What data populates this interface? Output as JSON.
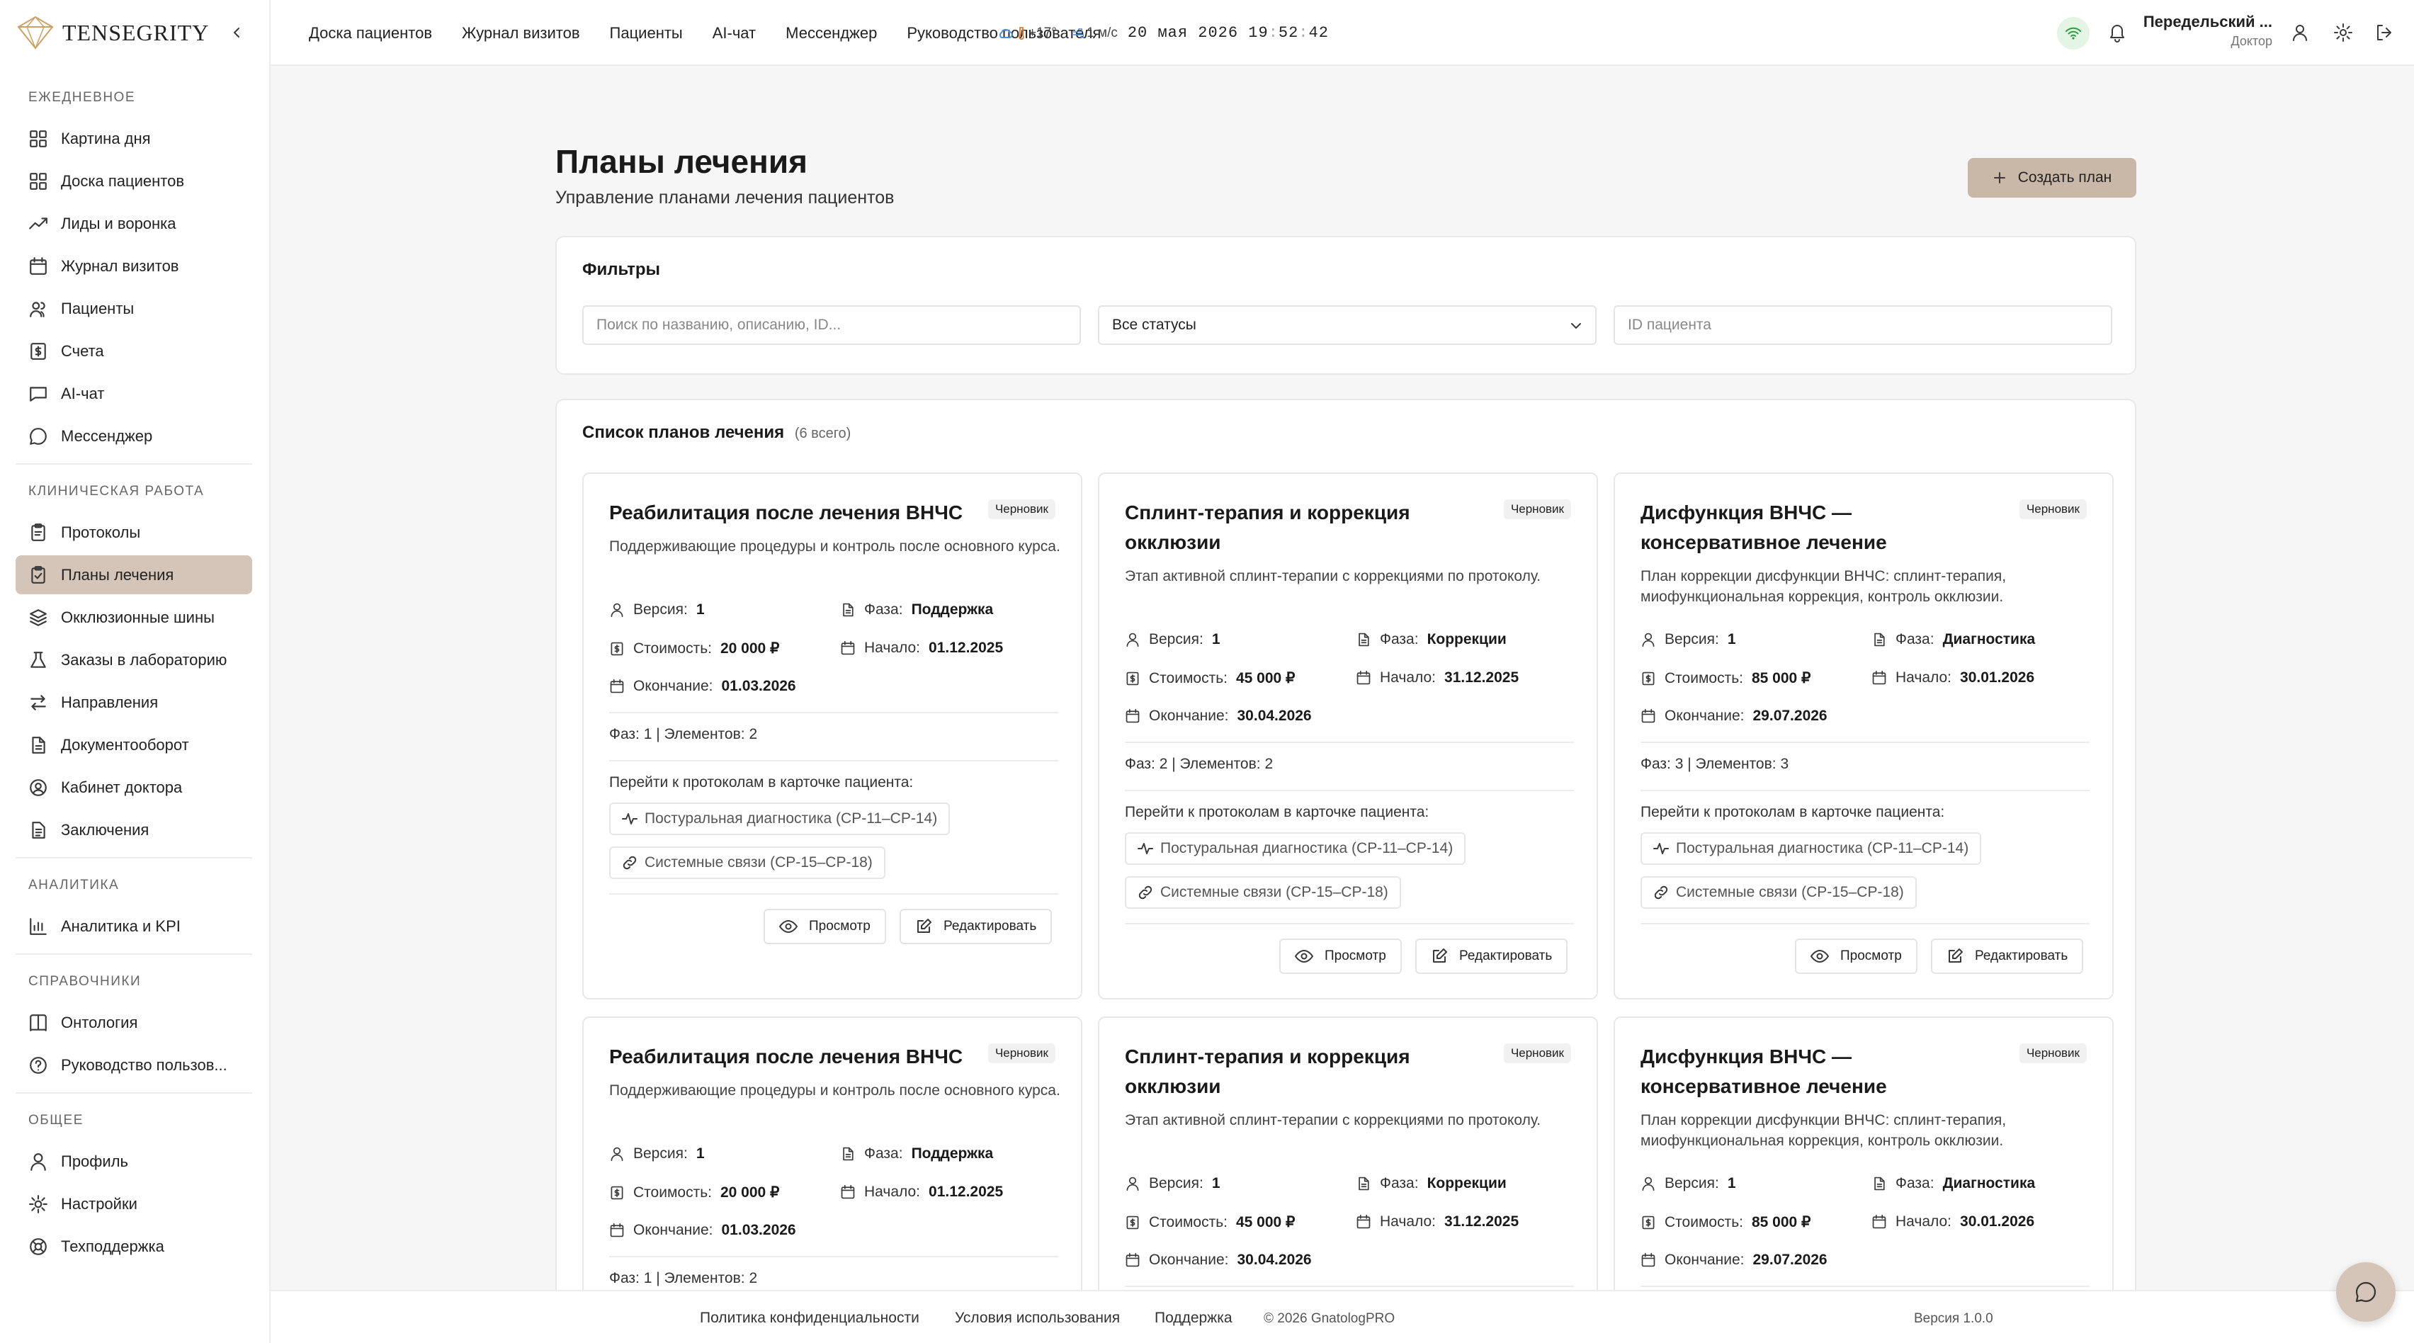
{
  "app": {
    "brand": "Tensegrity"
  },
  "sidebar": {
    "sections": [
      {
        "title": "Ежедневное",
        "items": [
          {
            "label": "Картина дня",
            "icon": "grid-icon"
          },
          {
            "label": "Доска пациентов",
            "icon": "grid-icon"
          },
          {
            "label": "Лиды и воронка",
            "icon": "trend-icon"
          },
          {
            "label": "Журнал визитов",
            "icon": "calendar-icon"
          },
          {
            "label": "Пациенты",
            "icon": "users-icon"
          },
          {
            "label": "Счета",
            "icon": "dollar-icon"
          },
          {
            "label": "AI-чат",
            "icon": "chat-icon"
          },
          {
            "label": "Мессенджер",
            "icon": "message-circle-icon"
          }
        ]
      },
      {
        "title": "Клиническая работа",
        "items": [
          {
            "label": "Протоколы",
            "icon": "clipboard-icon"
          },
          {
            "label": "Планы лечения",
            "icon": "clipboard-check-icon",
            "active": true
          },
          {
            "label": "Окклюзионные шины",
            "icon": "layers-icon"
          },
          {
            "label": "Заказы в лабораторию",
            "icon": "flask-icon"
          },
          {
            "label": "Направления",
            "icon": "arrows-icon"
          },
          {
            "label": "Документооборот",
            "icon": "file-icon"
          },
          {
            "label": "Кабинет доктора",
            "icon": "user-circle-icon"
          },
          {
            "label": "Заключения",
            "icon": "file-text-icon"
          }
        ]
      },
      {
        "title": "Аналитика",
        "items": [
          {
            "label": "Аналитика и KPI",
            "icon": "bar-chart-icon"
          }
        ]
      },
      {
        "title": "Справочники",
        "items": [
          {
            "label": "Онтология",
            "icon": "book-icon"
          },
          {
            "label": "Руководство пользов...",
            "icon": "help-circle-icon"
          }
        ]
      },
      {
        "title": "Общее",
        "items": [
          {
            "label": "Профиль",
            "icon": "user-icon"
          },
          {
            "label": "Настройки",
            "icon": "gear-icon"
          },
          {
            "label": "Техподдержка",
            "icon": "life-buoy-icon"
          }
        ]
      }
    ]
  },
  "topbar": {
    "nav": [
      "Доска пациентов",
      "Журнал визитов",
      "Пациенты",
      "AI-чат",
      "Мессенджер",
      "Руководство пользователя"
    ],
    "weather": {
      "temp": "+17°",
      "wind": "1 м/с"
    },
    "datetime": {
      "date": "20 мая 2026",
      "hh": "19",
      "mm": "52",
      "ss": "42"
    },
    "user": {
      "name": "Передельский ...",
      "role": "Доктор"
    }
  },
  "page": {
    "title": "Планы лечения",
    "subtitle": "Управление планами лечения пациентов",
    "create_label": "Создать план"
  },
  "filters": {
    "title": "Фильтры",
    "search_placeholder": "Поиск по названию, описанию, ID...",
    "status_value": "Все статусы",
    "patient_placeholder": "ID пациента"
  },
  "list": {
    "title": "Список планов лечения",
    "count": "(6 всего)",
    "labels": {
      "version": "Версия:",
      "phase": "Фаза:",
      "cost": "Стоимость:",
      "start": "Начало:",
      "end": "Окончание:",
      "hint": "Перейти к протоколам в карточке пациента:",
      "view": "Просмотр",
      "edit": "Редактировать"
    },
    "plans": [
      {
        "title": "Реабилитация после лечения ВНЧС",
        "status": "Черновик",
        "description": "Поддерживающие процедуры и контроль после основного курса.",
        "version": "1",
        "phase": "Поддержка",
        "cost": "20 000 ₽",
        "start": "01.12.2025",
        "end": "01.03.2026",
        "counts": "Фаз: 1 | Элементов: 2",
        "protocols": [
          "Постуральная диагностика (CP-11–CP-14)",
          "Системные связи (CP-15–CP-18)"
        ]
      },
      {
        "title": "Сплинт-терапия и коррекция окклюзии",
        "status": "Черновик",
        "description": "Этап активной сплинт-терапии с коррекциями по протоколу.",
        "version": "1",
        "phase": "Коррекции",
        "cost": "45 000 ₽",
        "start": "31.12.2025",
        "end": "30.04.2026",
        "counts": "Фаз: 2 | Элементов: 2",
        "protocols": [
          "Постуральная диагностика (CP-11–CP-14)",
          "Системные связи (CP-15–CP-18)"
        ]
      },
      {
        "title": "Дисфункция ВНЧС — консервативное лечение",
        "status": "Черновик",
        "description": "План коррекции дисфункции ВНЧС: сплинт-терапия, миофункциональная коррекция, контроль окклюзии.",
        "version": "1",
        "phase": "Диагностика",
        "cost": "85 000 ₽",
        "start": "30.01.2026",
        "end": "29.07.2026",
        "counts": "Фаз: 3 | Элементов: 3",
        "protocols": [
          "Постуральная диагностика (CP-11–CP-14)",
          "Системные связи (CP-15–CP-18)"
        ]
      },
      {
        "title": "Реабилитация после лечения ВНЧС",
        "status": "Черновик",
        "description": "Поддерживающие процедуры и контроль после основного курса.",
        "version": "1",
        "phase": "Поддержка",
        "cost": "20 000 ₽",
        "start": "01.12.2025",
        "end": "01.03.2026",
        "counts": "Фаз: 1 | Элементов: 2",
        "protocols": []
      },
      {
        "title": "Сплинт-терапия и коррекция окклюзии",
        "status": "Черновик",
        "description": "Этап активной сплинт-терапии с коррекциями по протоколу.",
        "version": "1",
        "phase": "Коррекции",
        "cost": "45 000 ₽",
        "start": "31.12.2025",
        "end": "30.04.2026",
        "counts": "",
        "protocols": []
      },
      {
        "title": "Дисфункция ВНЧС — консервативное лечение",
        "status": "Черновик",
        "description": "План коррекции дисфункции ВНЧС: сплинт-терапия, миофункциональная коррекция, контроль окклюзии.",
        "version": "1",
        "phase": "Диагностика",
        "cost": "85 000 ₽",
        "start": "30.01.2026",
        "end": "29.07.2026",
        "counts": "",
        "protocols": []
      }
    ]
  },
  "footer": {
    "privacy": "Политика конфиденциальности",
    "terms": "Условия использования",
    "support": "Поддержка",
    "copyright": "© 2026 GnatologPRO",
    "version": "Версия 1.0.0"
  }
}
